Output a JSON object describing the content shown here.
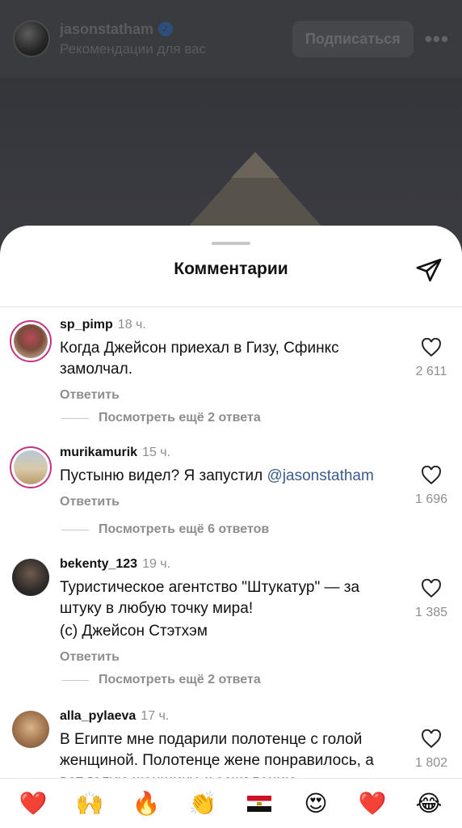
{
  "post": {
    "username": "jasonstatham",
    "subtitle": "Рекомендации для вас",
    "follow_label": "Подписаться",
    "more_label": "•••"
  },
  "sheet": {
    "title": "Комментарии"
  },
  "comments": [
    {
      "user": "sp_pimp",
      "time": "18 ч.",
      "text": "Когда Джейсон приехал в Гизу, Сфинкс замолчал.",
      "reply_label": "Ответить",
      "likes": "2 611",
      "more_replies": "Посмотреть ещё 2 ответа"
    },
    {
      "user": "murikamurik",
      "time": "15 ч.",
      "text": "Пустыню видел? Я запустил ",
      "mention": "@jasonstatham",
      "reply_label": "Ответить",
      "likes": "1 696",
      "more_replies": "Посмотреть ещё 6 ответов"
    },
    {
      "user": "bekenty_123",
      "time": "19 ч.",
      "text": "Туристическое агентство \"Штукатур\" — за штуку в любую точку мира!",
      "text2": "(с) Джейсон Стэтхэм",
      "reply_label": "Ответить",
      "likes": "1 385",
      "more_replies": "Посмотреть ещё 2 ответа"
    },
    {
      "user": "alla_pylaeva",
      "time": "17 ч.",
      "text": "В Египте мне подарили полотенце с голой женщиной. Полотенце жене понравилось, а вот голую женщину, к сожалению",
      "likes": "1 802"
    }
  ],
  "reactions": [
    "❤️",
    "🙌",
    "🔥",
    "👏",
    "egypt-flag",
    "😍",
    "❤️",
    "😂"
  ]
}
